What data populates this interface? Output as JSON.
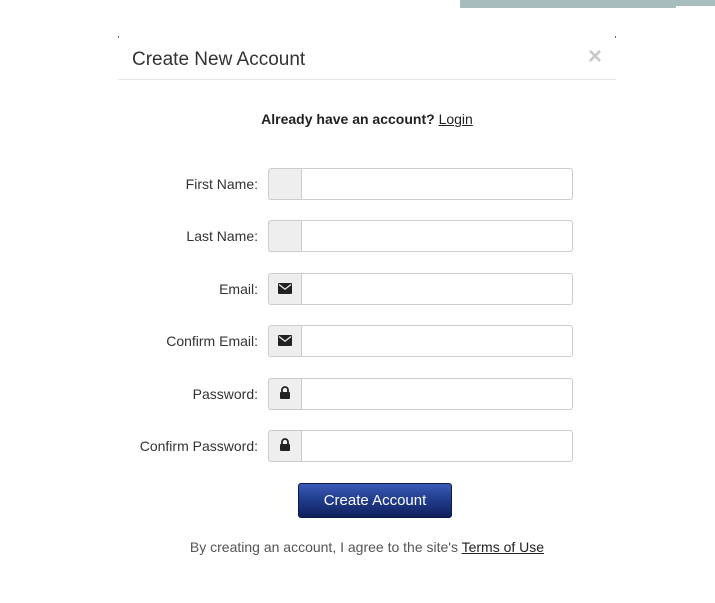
{
  "modal": {
    "title": "Create New Account",
    "close_symbol": "×"
  },
  "login_prompt": {
    "text": "Already have an account?",
    "link_text": "Login"
  },
  "form": {
    "fields": [
      {
        "label": "First Name:",
        "icon": "none",
        "value": "",
        "placeholder": ""
      },
      {
        "label": "Last Name:",
        "icon": "none",
        "value": "",
        "placeholder": ""
      },
      {
        "label": "Email:",
        "icon": "envelope-icon",
        "value": "",
        "placeholder": ""
      },
      {
        "label": "Confirm Email:",
        "icon": "envelope-icon",
        "value": "",
        "placeholder": ""
      },
      {
        "label": "Password:",
        "icon": "lock-icon",
        "value": "",
        "placeholder": ""
      },
      {
        "label": "Confirm Password:",
        "icon": "lock-icon",
        "value": "",
        "placeholder": ""
      }
    ],
    "submit_label": "Create Account"
  },
  "terms": {
    "text": "By creating an account, I agree to the site's",
    "link_text": "Terms of Use"
  },
  "colors": {
    "button_top": "#3a5ab6",
    "button_bottom": "#0f1f5c",
    "top_strip": "#a6bcbd",
    "addon_bg": "#eeeeee",
    "border": "#cccccc"
  }
}
